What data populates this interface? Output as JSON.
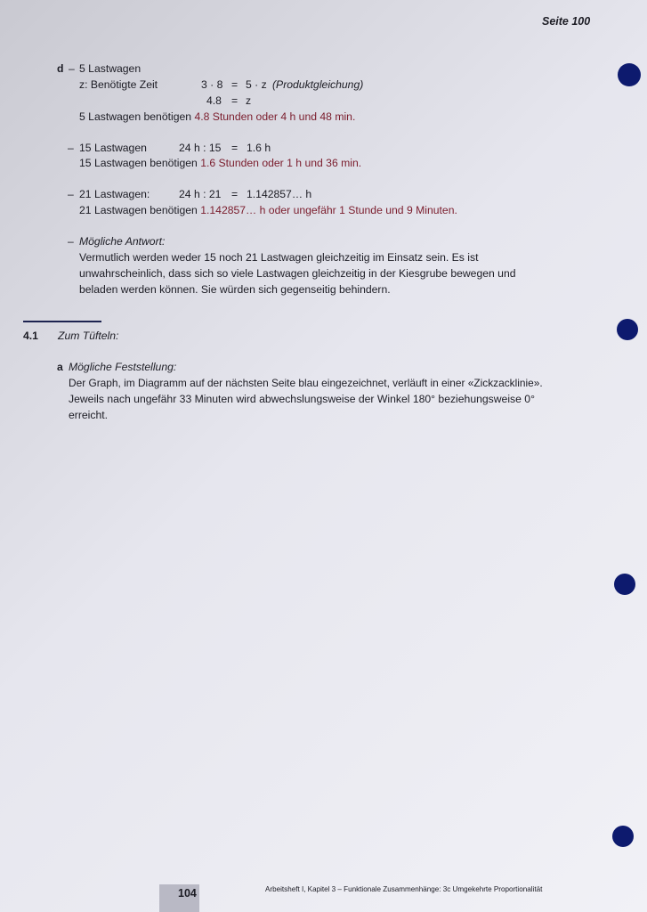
{
  "header": {
    "seite": "Seite 100"
  },
  "section_d": {
    "letter": "d",
    "dash": "–",
    "item1": {
      "title": "5 Lastwagen",
      "z_label": "z: Benötigte Zeit",
      "eq1_left": "3 · 8",
      "eq1_mid": "=",
      "eq1_right": "5 · z",
      "eq1_note": "(Produktgleichung)",
      "eq2_left": "4.8",
      "eq2_mid": "=",
      "eq2_right": "z",
      "ans_prefix": "5 Lastwagen benötigen ",
      "ans_value": "4.8 Stunden oder 4 h und 48 min."
    },
    "item2": {
      "dash": "–",
      "title": "15 Lastwagen",
      "eq_left": "24 h : 15",
      "eq_mid": "=",
      "eq_right": "1.6 h",
      "ans_prefix": "15 Lastwagen benötigen ",
      "ans_value": "1.6 Stunden oder 1 h und 36 min."
    },
    "item3": {
      "dash": "–",
      "title": "21 Lastwagen:",
      "eq_left": "24 h : 21",
      "eq_mid": "=",
      "eq_right": "1.142857… h",
      "ans_prefix": "21 Lastwagen benötigen ",
      "ans_value": "1.142857… h oder ungefähr 1 Stunde und 9 Minuten."
    },
    "item4": {
      "dash": "–",
      "title": "Mögliche Antwort:",
      "line1": "Vermutlich werden weder 15 noch 21 Lastwagen gleichzeitig im Einsatz sein. Es ist",
      "line2": "unwahrscheinlich, dass sich so viele Lastwagen gleichzeitig in der Kiesgrube bewegen und",
      "line3": "beladen werden können. Sie würden sich gegenseitig behindern."
    }
  },
  "section_41": {
    "number": "4.1",
    "title": "Zum Tüfteln:",
    "a_letter": "a",
    "a_title": "Mögliche Feststellung:",
    "line1": "Der Graph, im Diagramm auf der nächsten Seite blau eingezeichnet, verläuft in einer «Zickzacklinie».",
    "line2": "Jeweils nach ungefähr 33 Minuten wird abwechslungsweise der Winkel 180° beziehungsweise 0°",
    "line3": "erreicht."
  },
  "footer": {
    "page_number": "104",
    "text": "Arbeitsheft I, Kapitel 3 – Funktionale Zusammenhänge: 3c Umgekehrte Proportionalität"
  },
  "colors": {
    "answer": "#7a1c2c",
    "hole": "#0d1a6e",
    "text": "#1c1c24"
  }
}
